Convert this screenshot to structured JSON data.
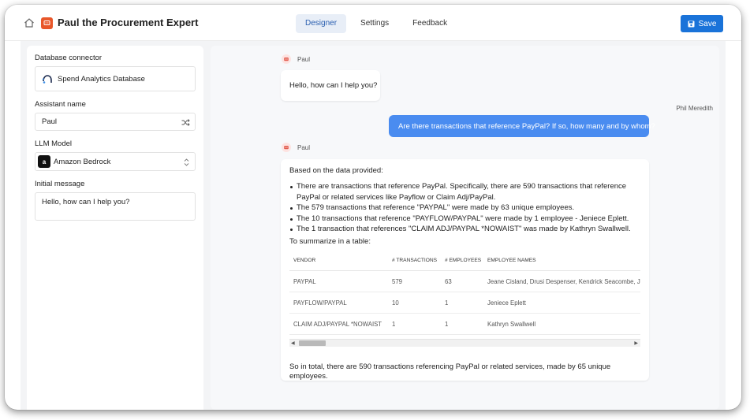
{
  "header": {
    "home_icon": "home-icon",
    "app_icon": "assistant-chat-icon",
    "title": "Paul the Procurement Expert",
    "tabs": [
      {
        "label": "Designer",
        "active": true
      },
      {
        "label": "Settings",
        "active": false
      },
      {
        "label": "Feedback",
        "active": false
      }
    ],
    "save_label": "Save",
    "save_icon": "floppy-disk-icon",
    "accent_color": "#1a73d9"
  },
  "config": {
    "db_label": "Database connector",
    "db_value": "Spend Analytics Database",
    "name_label": "Assistant name",
    "name_value": "Paul",
    "model_label": "LLM Model",
    "model_value": "Amazon Bedrock",
    "init_label": "Initial message",
    "init_value": "Hello, how can I help you?"
  },
  "chat": {
    "messages": [
      {
        "sender": "Paul",
        "text": "Hello, how can I help you?"
      },
      {
        "sender": "Phil Meredith",
        "text": "Are there transactions that reference PayPal? If so, how many and by whom?"
      }
    ],
    "answer": {
      "sender": "Paul",
      "intro": "Based on the data provided:",
      "bullets": [
        "There are transactions that reference PayPal. Specifically, there are 590 transactions that reference PayPal or related services like Payflow or Claim Adj/PayPal.",
        "The 579 transactions that reference \"PAYPAL\" were made by 63 unique employees.",
        "The 10 transactions that reference \"PAYFLOW/PAYPAL\" were made by 1 employee - Jeniece Eplett.",
        "The 1 transaction that references \"CLAIM ADJ/PAYPAL *NOWAIST\" was made by Kathryn Swallwell."
      ],
      "table_intro": "To summarize in a table:",
      "table": {
        "headers": [
          "VENDOR",
          "# TRANSACTIONS",
          "# EMPLOYEES",
          "EMPLOYEE NAMES"
        ],
        "rows": [
          [
            "PAYPAL",
            "579",
            "63",
            "Jeane Cisland, Drusi Despenser, Kendrick Seacombe, Jos"
          ],
          [
            "PAYFLOW/PAYPAL",
            "10",
            "1",
            "Jeniece Eplett"
          ],
          [
            "CLAIM ADJ/PAYPAL *NOWAIST",
            "1",
            "1",
            "Kathryn Swallwell"
          ]
        ]
      },
      "summary": "So in total, there are 590 transactions referencing PayPal or related services, made by 65 unique employees."
    }
  }
}
